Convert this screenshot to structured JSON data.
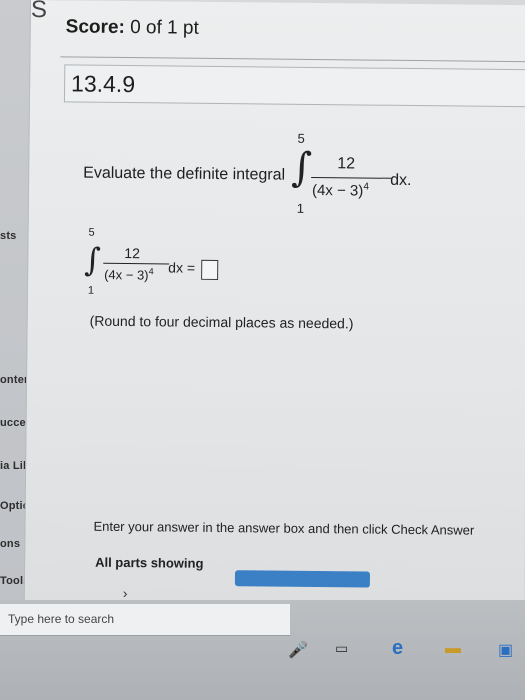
{
  "sidebar": {
    "items": [
      {
        "label": "sts",
        "top": 0
      },
      {
        "label": "ontents"
      },
      {
        "label": "uccess"
      },
      {
        "label": "ia Librai"
      },
      {
        "label": "Options"
      },
      {
        "label": "ons"
      },
      {
        "label": "Tools"
      }
    ]
  },
  "header": {
    "logo": "S",
    "score_label": "Score:",
    "score_value": "0 of 1 pt",
    "question_id": "13.4.9"
  },
  "question": {
    "prompt": "Evaluate the definite integral",
    "upper_limit": "5",
    "lower_limit": "1",
    "numerator": "12",
    "denominator": "(4x − 3)",
    "exponent": "4",
    "dx": "dx.",
    "answer_dx": "dx =",
    "hint": "(Round to four decimal places as needed.)"
  },
  "footer": {
    "instruction": "Enter your answer in the answer box and then click Check Answer",
    "parts_label": "All parts showing",
    "chevron": "›"
  },
  "taskbar": {
    "search_placeholder": "Type here to search"
  }
}
